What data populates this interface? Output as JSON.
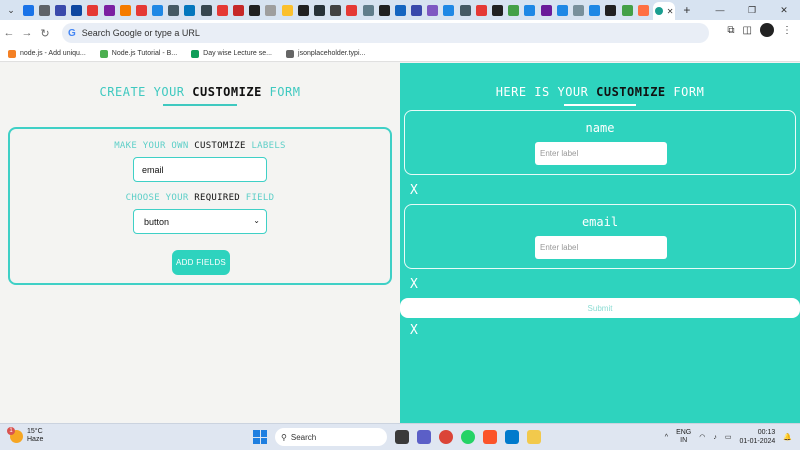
{
  "browser": {
    "omnibox_text": "Search Google or type a URL",
    "bookmarks": [
      {
        "label": "node.js - Add uniqu...",
        "color": "#f48024"
      },
      {
        "label": "Node.js Tutorial - B...",
        "color": "#4caf50"
      },
      {
        "label": "Day wise Lecture se...",
        "color": "#0f9d58"
      },
      {
        "label": "jsonplaceholder.typi...",
        "color": "#666666"
      }
    ],
    "tab_favicon_colors": [
      "#1a73e8",
      "#5f6368",
      "#3949ab",
      "#0d47a1",
      "#e53935",
      "#7b1fa2",
      "#f57c00",
      "#e53935",
      "#1e88e5",
      "#455a64",
      "#0277bd",
      "#37474f",
      "#e53935",
      "#c62828",
      "#212121",
      "#9e9e9e",
      "#fbc02d",
      "#212121",
      "#263238",
      "#424242",
      "#e53935",
      "#607d8b",
      "#212121",
      "#1565c0",
      "#3949ab",
      "#7e57c2",
      "#1e88e5",
      "#455a64",
      "#e53935",
      "#212121",
      "#43a047",
      "#1e88e5",
      "#6a1b9a",
      "#1e88e5",
      "#78909c",
      "#1e88e5",
      "#212121",
      "#43a047",
      "#ff7043"
    ]
  },
  "left": {
    "heading": {
      "part1": "CREATE YOUR",
      "part2": "CUSTOMIZE",
      "part3": "FORM"
    },
    "label_prompt": {
      "part1": "MAKE YOUR OWN",
      "part2": "CUSTOMIZE",
      "part3": "LABELS"
    },
    "label_input_value": "email",
    "field_prompt": {
      "part1": "CHOOSE YOUR",
      "part2": "REQUIRED",
      "part3": "FIELD"
    },
    "field_select_value": "button",
    "add_button": "ADD FIELDS"
  },
  "right": {
    "heading": {
      "part1": "HERE IS YOUR",
      "part2": "CUSTOMIZE",
      "part3": "FORM"
    },
    "fields": [
      {
        "title": "name",
        "placeholder": "Enter label"
      },
      {
        "title": "email",
        "placeholder": "Enter label"
      }
    ],
    "remove_mark": "X",
    "submit_label": "Submit"
  },
  "taskbar": {
    "weather_temp": "15°C",
    "weather_desc": "Haze",
    "weather_badge": "1",
    "search_label": "Search",
    "lang_1": "ENG",
    "lang_2": "IN",
    "time": "00:13",
    "date": "01-01-2024"
  },
  "colors": {
    "accent": "#2ed3be",
    "left_bg": "#f4f4f2"
  }
}
